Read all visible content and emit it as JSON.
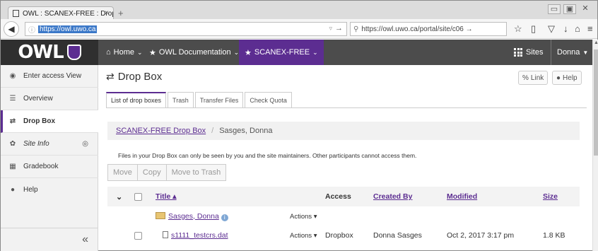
{
  "browser": {
    "tab_title": "OWL : SCANEX-FREE : Drop B",
    "tab_close": "×",
    "new_tab": "+",
    "url": "https://owl.uwo.ca",
    "search_text": "https://owl.uwo.ca/portal/site/c06 →",
    "win_min": "▭",
    "win_max": "▣",
    "win_close": "✕"
  },
  "header": {
    "logo_text": "OWL",
    "nav": [
      {
        "label": "Home"
      },
      {
        "label": "OWL Documentation"
      },
      {
        "label": "SCANEX-FREE"
      }
    ],
    "sites_label": "Sites",
    "user_label": "Donna"
  },
  "sidebar": {
    "items": [
      {
        "label": "Enter access View"
      },
      {
        "label": "Overview"
      },
      {
        "label": "Drop Box"
      },
      {
        "label": "Site Info"
      },
      {
        "label": "Gradebook"
      },
      {
        "label": "Help"
      }
    ],
    "collapse_label": "«"
  },
  "main": {
    "title": "Drop Box",
    "link_label": "Link",
    "help_label": "Help",
    "tabs": [
      {
        "label": "List of drop boxes"
      },
      {
        "label": "Trash"
      },
      {
        "label": "Transfer Files"
      },
      {
        "label": "Check Quota"
      }
    ],
    "breadcrumb": {
      "link": "SCANEX-FREE Drop Box",
      "separator": "/",
      "current": "Sasges, Donna"
    },
    "note": "Files in your Drop Box can only be seen by you and the site maintainers. Other participants cannot access them.",
    "actions": {
      "move": "Move",
      "copy": "Copy",
      "trash": "Move to Trash"
    },
    "table": {
      "headers": {
        "title": "Title ▴",
        "access": "Access",
        "created_by": "Created By",
        "modified": "Modified",
        "size": "Size"
      },
      "rows": [
        {
          "title": "Sasges, Donna",
          "actions": "Actions ▾",
          "access": "",
          "created_by": "",
          "modified": "",
          "size": ""
        },
        {
          "title": "s1111_testcrs.dat",
          "actions": "Actions ▾",
          "access": "Dropbox",
          "created_by": "Donna Sasges",
          "modified": "Oct 2, 2017 3:17 pm",
          "size": "1.8 KB"
        }
      ]
    }
  }
}
